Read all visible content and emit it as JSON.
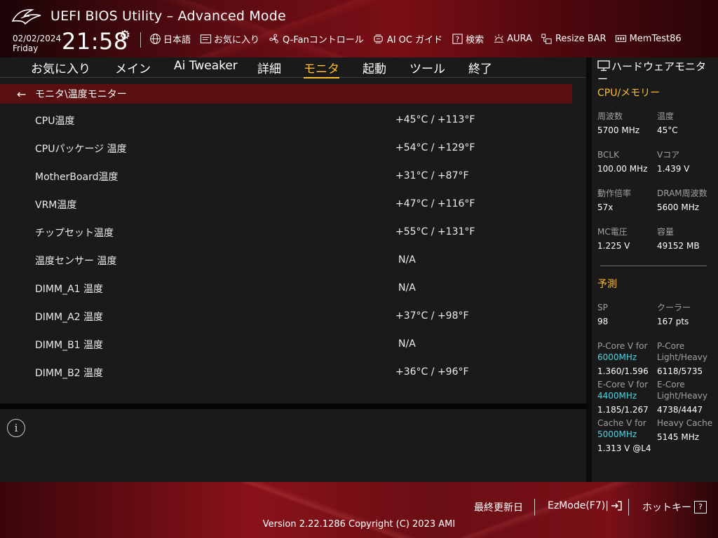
{
  "header": {
    "title": "UEFI BIOS Utility – Advanced Mode",
    "date": "02/02/2024",
    "day": "Friday",
    "time": "21:58"
  },
  "toolbar": [
    {
      "icon": "globe-icon",
      "label": "日本語"
    },
    {
      "icon": "favorites-icon",
      "label": "お気に入り"
    },
    {
      "icon": "fan-icon",
      "label": "Q-Fanコントロール"
    },
    {
      "icon": "ai-oc-icon",
      "label": "AI OC ガイド"
    },
    {
      "icon": "help-search-icon",
      "label": "検索"
    },
    {
      "icon": "aura-icon",
      "label": "AURA"
    },
    {
      "icon": "resize-bar-icon",
      "label": "Resize BAR"
    },
    {
      "icon": "memtest-icon",
      "label": "MemTest86"
    }
  ],
  "tabs": [
    {
      "label": "お気に入り",
      "active": false
    },
    {
      "label": "メイン",
      "active": false
    },
    {
      "label": "Ai Tweaker",
      "active": false
    },
    {
      "label": "詳細",
      "active": false
    },
    {
      "label": "モニタ",
      "active": true
    },
    {
      "label": "起動",
      "active": false
    },
    {
      "label": "ツール",
      "active": false
    },
    {
      "label": "終了",
      "active": false
    }
  ],
  "breadcrumb": "モニタ\\温度モニター",
  "rows": [
    {
      "label": "CPU温度",
      "value": "+45°C / +113°F"
    },
    {
      "label": "CPUパッケージ 温度",
      "value": "+54°C / +129°F"
    },
    {
      "label": "MotherBoard温度",
      "value": "+31°C / +87°F"
    },
    {
      "label": "VRM温度",
      "value": "+47°C / +116°F"
    },
    {
      "label": "チップセット温度",
      "value": "+55°C / +131°F"
    },
    {
      "label": "温度センサー 温度",
      "value": "N/A"
    },
    {
      "label": "DIMM_A1 温度",
      "value": "N/A"
    },
    {
      "label": "DIMM_A2 温度",
      "value": "+37°C / +98°F"
    },
    {
      "label": "DIMM_B1 温度",
      "value": "N/A"
    },
    {
      "label": "DIMM_B2 温度",
      "value": "+36°C / +96°F"
    }
  ],
  "hw": {
    "title": "ハードウェアモニター",
    "cpu_section": "CPU/メモリー",
    "freq_label": "周波数",
    "freq": "5700 MHz",
    "temp_label": "温度",
    "temp": "45°C",
    "bclk_label": "BCLK",
    "bclk": "100.00 MHz",
    "vcore_label": "Vコア",
    "vcore": "1.439 V",
    "ratio_label": "動作倍率",
    "ratio": "57x",
    "dram_label": "DRAM周波数",
    "dram": "5600 MHz",
    "mc_label": "MC電圧",
    "mc": "1.225 V",
    "cap_label": "容量",
    "cap": "49152 MB",
    "predict_section": "予測",
    "sp_label": "SP",
    "sp": "98",
    "cooler_label": "クーラー",
    "cooler": "167 pts",
    "pcore_v_label": "P-Core V for",
    "pcore_v_freq": "6000MHz",
    "pcore_v": "1.360/1.596",
    "pcore_lh_label": "P-Core",
    "pcore_lh_label2": "Light/Heavy",
    "pcore_lh": "6118/5735",
    "ecore_v_label": "E-Core V for",
    "ecore_v_freq": "4400MHz",
    "ecore_v": "1.185/1.267",
    "ecore_lh_label": "E-Core",
    "ecore_lh_label2": "Light/Heavy",
    "ecore_lh": "4738/4447",
    "cache_v_label": "Cache V for",
    "cache_v_freq": "5000MHz",
    "cache_v": "1.313 V @L4",
    "heavy_cache_label": "Heavy Cache",
    "heavy_cache": "5145 MHz"
  },
  "footer": {
    "last_modified": "最終更新日",
    "ezmode": "EzMode(F7)|",
    "hotkey": "ホットキー",
    "hotkey_key": "?",
    "version": "Version 2.22.1286 Copyright (C) 2023 AMI"
  }
}
